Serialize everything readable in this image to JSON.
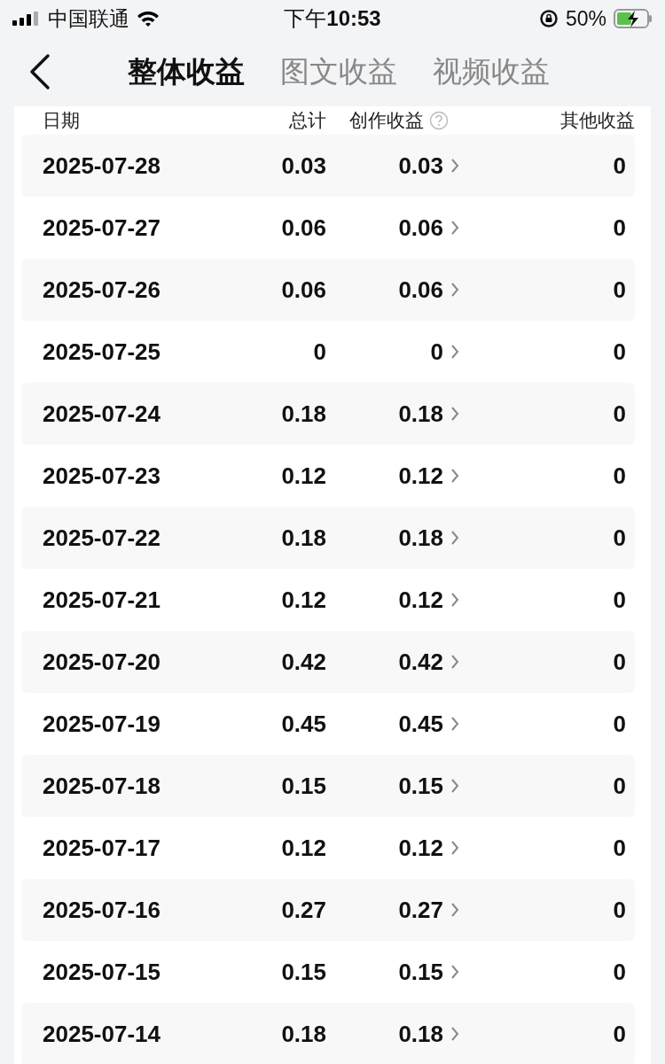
{
  "status_bar": {
    "carrier": "中国联通",
    "time": "下午**10:53**",
    "battery": "50%"
  },
  "tabs": [
    {
      "label": "整体收益",
      "selected": true
    },
    {
      "label": "图文收益",
      "selected": false
    },
    {
      "label": "视频收益",
      "selected": false
    }
  ],
  "table": {
    "columns": [
      "日期",
      "总计",
      "创作收益",
      "其他收益"
    ],
    "rows": [
      [
        "2025-07-28",
        "0.03",
        "0.03",
        "0"
      ],
      [
        "2025-07-27",
        "0.06",
        "0.06",
        "0"
      ],
      [
        "2025-07-26",
        "0.06",
        "0.06",
        "0"
      ],
      [
        "2025-07-25",
        "0",
        "0",
        "0"
      ],
      [
        "2025-07-24",
        "0.18",
        "0.18",
        "0"
      ],
      [
        "2025-07-23",
        "0.12",
        "0.12",
        "0"
      ],
      [
        "2025-07-22",
        "0.18",
        "0.18",
        "0"
      ],
      [
        "2025-07-21",
        "0.12",
        "0.12",
        "0"
      ],
      [
        "2025-07-20",
        "0.42",
        "0.42",
        "0"
      ],
      [
        "2025-07-19",
        "0.45",
        "0.45",
        "0"
      ],
      [
        "2025-07-18",
        "0.15",
        "0.15",
        "0"
      ],
      [
        "2025-07-17",
        "0.12",
        "0.12",
        "0"
      ],
      [
        "2025-07-16",
        "0.27",
        "0.27",
        "0"
      ],
      [
        "2025-07-15",
        "0.15",
        "0.15",
        "0"
      ],
      [
        "2025-07-14",
        "0.18",
        "0.18",
        "0"
      ]
    ]
  }
}
